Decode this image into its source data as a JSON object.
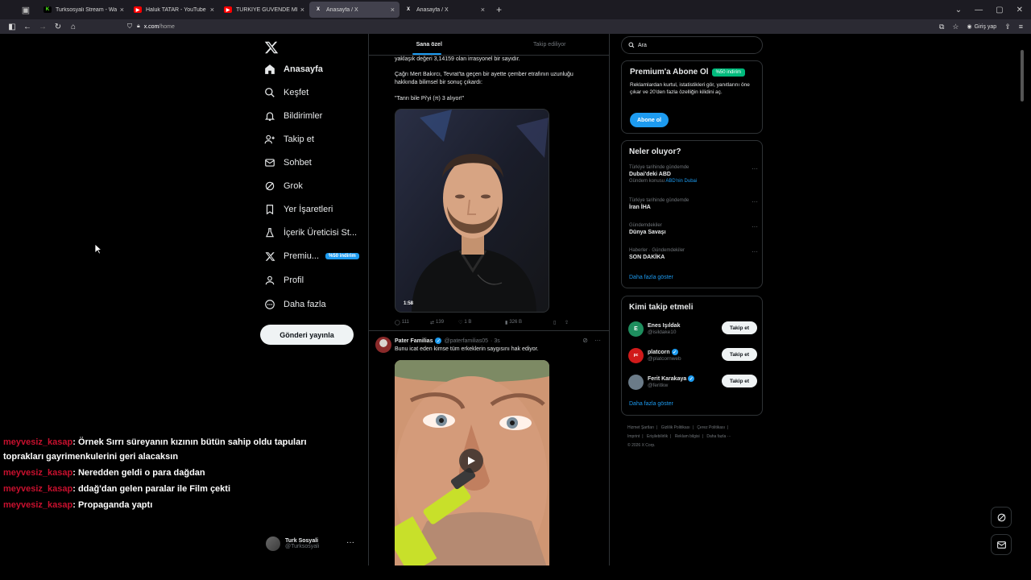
{
  "browser": {
    "tabs": [
      {
        "title": "Turksosyali Stream - Watch",
        "color": "#53fc18",
        "glyph": "K"
      },
      {
        "title": "Haluk TATAR - YouTube",
        "color": "#ff0000",
        "glyph": "▶"
      },
      {
        "title": "TÜRKİYE GÜVENDE Mİ? - S",
        "color": "#ff0000",
        "glyph": "▶"
      },
      {
        "title": "Anasayfa / X",
        "color": "#000000",
        "glyph": "X"
      },
      {
        "title": "Anasayfa / X",
        "color": "#000000",
        "glyph": "X"
      }
    ],
    "url_host": "x.com",
    "url_path": "/home",
    "signin_label": "Giriş yap"
  },
  "nav": {
    "items": [
      {
        "label": "Anasayfa",
        "icon": "home-icon"
      },
      {
        "label": "Keşfet",
        "icon": "search-icon"
      },
      {
        "label": "Bildirimler",
        "icon": "bell-icon"
      },
      {
        "label": "Takip et",
        "icon": "add-person-icon"
      },
      {
        "label": "Sohbet",
        "icon": "envelope-icon"
      },
      {
        "label": "Grok",
        "icon": "grok-icon"
      },
      {
        "label": "Yer İşaretleri",
        "icon": "bookmark-icon"
      },
      {
        "label": "İçerik Üreticisi St...",
        "icon": "creator-icon"
      },
      {
        "label": "Premiu...",
        "icon": "x-icon"
      },
      {
        "label": "Profil",
        "icon": "person-icon"
      },
      {
        "label": "Daha fazla",
        "icon": "more-circle-icon"
      }
    ],
    "premium_badge": "%50 indirim",
    "post_button": "Gönderi yayınla",
    "account_name": "Turk Sosyali",
    "account_handle": "@Turksosyali"
  },
  "timeline": {
    "tabs": [
      "Sana özel",
      "Takip ediliyor"
    ],
    "tweet1": {
      "line1": "yaklaşık değeri 3,14159 olan irrasyonel bir sayıdır.",
      "para2_line1": "Çağrı Mert Bakırcı, Tevrat'ta geçen bir ayette çember etrafının uzunluğu",
      "para2_line2": "hakkında bilimsel bir sonuç çıkardı:",
      "quote": "\"Tanrı bile Pi'yi (π) 3 alıyor!\"",
      "duration": "1:58",
      "replies": "111",
      "reposts": "139",
      "likes": "1 B",
      "views": "326 B"
    },
    "tweet2": {
      "name": "Pater Familias",
      "handle": "@paterfamilias05",
      "time": "· 3s",
      "text": "Bunu icat eden kimse tüm erkeklerin saygısını hak ediyor."
    }
  },
  "sidebar": {
    "search_placeholder": "Ara",
    "premium": {
      "title": "Premium'a Abone Ol",
      "discount": "%50 indirim",
      "body": "Reklamlardan kurtul, istatistikleri gör, yanıtlarını öne çıkar ve 20'den fazla özelliğin kilidini aç.",
      "button": "Abone ol"
    },
    "trends": {
      "title": "Neler oluyor?",
      "items": [
        {
          "meta": "Türkiye tarihinde gündemde",
          "name": "Dubai'deki ABD",
          "sub_prefix": "Gündem konusu",
          "sub_link": "ABD'nin Dubai"
        },
        {
          "meta": "Türkiye tarihinde gündemde",
          "name": "İran İHA",
          "sub_prefix": "",
          "sub_link": ""
        },
        {
          "meta": "Gündemdekiler",
          "name": "Dünya Savaşı",
          "sub_prefix": "",
          "sub_link": ""
        },
        {
          "meta": "Haberler · Gündemdekiler",
          "name": "SON DAKİKA",
          "sub_prefix": "",
          "sub_link": ""
        }
      ],
      "show_more": "Daha fazla göster"
    },
    "who_to_follow": {
      "title": "Kimi takip etmeli",
      "users": [
        {
          "name": "Enes Işıldak",
          "handle": "@isildake10",
          "verified": false,
          "avatar_color": "#1e8e5e",
          "initial": "E"
        },
        {
          "name": "platcorn",
          "handle": "@platcornweb",
          "verified": true,
          "avatar_color": "#d11a1a",
          "initial": "pc"
        },
        {
          "name": "Ferit Karakaya",
          "handle": "@feritkw",
          "verified": true,
          "avatar_color": "#6b7b88",
          "initial": ""
        }
      ],
      "follow_label": "Takip et",
      "show_more": "Daha fazla göster"
    },
    "footer": {
      "line1": [
        "Hizmet Şartları",
        "|",
        "Gizlilik Politikası",
        "|",
        "Çerez Politikası",
        "|"
      ],
      "line2": [
        "Imprint",
        "|",
        "Erişilebilirlik",
        "|",
        "Reklam bilgisi",
        "|",
        "Daha fazla ···"
      ],
      "copyright": "© 2026 X Corp."
    }
  },
  "chat": [
    {
      "user": "meyvesiz_kasap",
      "text": ": Örnek Sırrı süreyanın kızının bütün sahip oldu tapuları"
    },
    {
      "user": "",
      "text": "toprakları gayrimenkulerini geri alacaksın"
    },
    {
      "user": "meyvesiz_kasap",
      "text": ": Neredden geldi o para dağdan"
    },
    {
      "user": "meyvesiz_kasap",
      "text": ": ddağ'dan gelen paralar ile Film çekti"
    },
    {
      "user": "meyvesiz_kasap",
      "text": ": Propaganda yaptı"
    }
  ]
}
